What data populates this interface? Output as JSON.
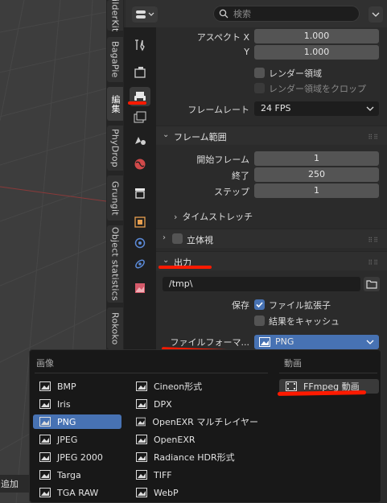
{
  "side_tabs": [
    "ilderKit",
    "BagaPie",
    "編集",
    "PhyDrop",
    "Grungit",
    "Object statistics",
    "Rokoko"
  ],
  "header": {
    "search_placeholder": "検索"
  },
  "format": {
    "aspect_x_label": "アスペクト X",
    "aspect_x_value": "1.000",
    "aspect_y_label": "Y",
    "aspect_y_value": "1.000",
    "render_region_label": "レンダー領域",
    "crop_region_label": "レンダー領域をクロップ",
    "frame_rate_label": "フレームレート",
    "frame_rate_value": "24 FPS"
  },
  "frame_range": {
    "title": "フレーム範囲",
    "start_label": "開始フレーム",
    "start_value": "1",
    "end_label": "終了",
    "end_value": "250",
    "step_label": "ステップ",
    "step_value": "1",
    "time_stretch_label": "タイムストレッチ"
  },
  "stereo": {
    "title": "立体視"
  },
  "output": {
    "title": "出力",
    "path": "/tmp\\",
    "save_label": "保存",
    "file_ext_label": "ファイル拡張子",
    "cache_label": "結果をキャッシュ",
    "file_format_label": "ファイルフォーマ...",
    "file_format_value": "PNG"
  },
  "popup": {
    "image_header": "画像",
    "movie_header": "動画",
    "col1": [
      "BMP",
      "Iris",
      "PNG",
      "JPEG",
      "JPEG 2000",
      "Targa",
      "TGA RAW"
    ],
    "col2": [
      "Cineon形式",
      "DPX",
      "OpenEXR マルチレイヤー",
      "OpenEXR",
      "Radiance HDR形式",
      "TIFF",
      "WebP"
    ],
    "movie": [
      "FFmpeg 動画"
    ]
  },
  "footer_text": "追加",
  "colors": {
    "accent": "#4772b3",
    "annotation": "#ff1a00"
  }
}
